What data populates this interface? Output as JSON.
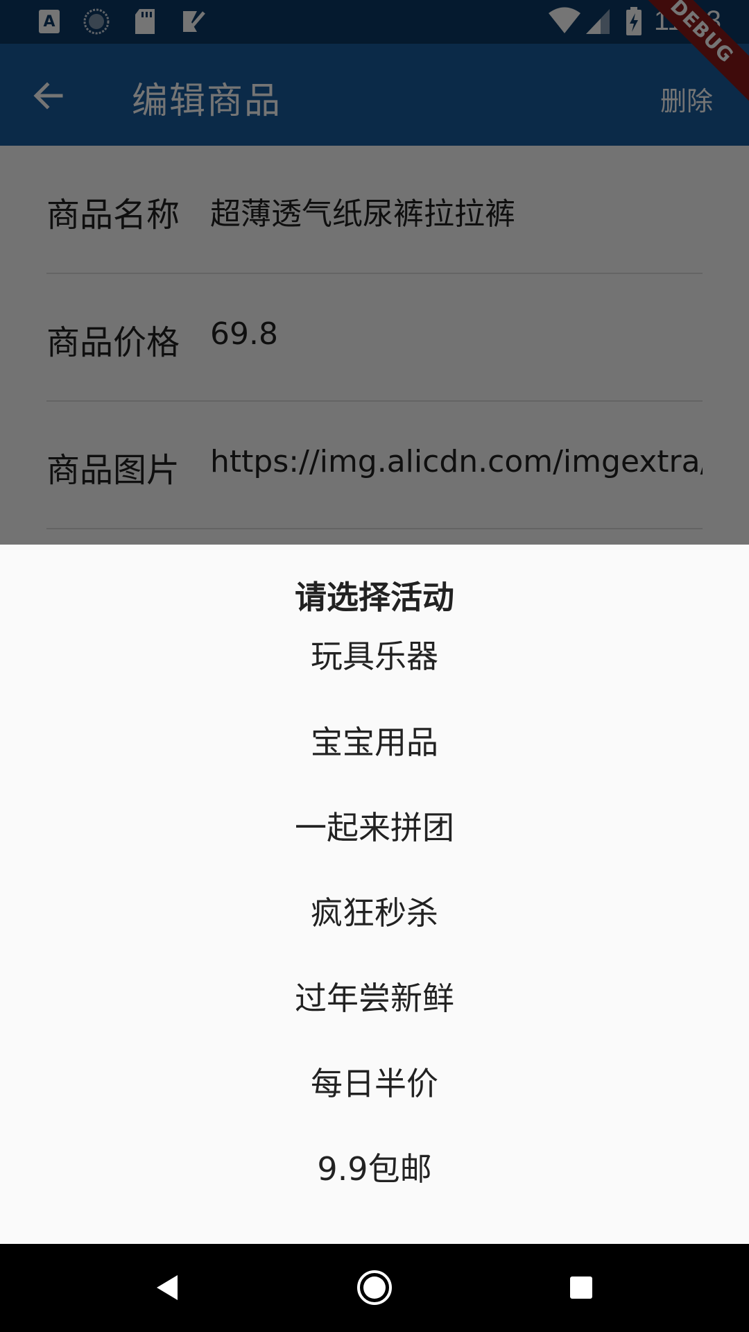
{
  "status_bar": {
    "time": "11:43",
    "left_icons": [
      "keyboard-a-icon",
      "sync-circle-icon",
      "sd-card-icon",
      "task-check-icon"
    ],
    "right_icons": [
      "wifi-icon",
      "cellular-signal-icon",
      "battery-charging-icon"
    ],
    "debug_banner": "DEBUG",
    "background": "#0d3a66"
  },
  "app_bar": {
    "title": "编辑商品",
    "delete_label": "删除",
    "background": "#1a5c9e"
  },
  "form": {
    "rows": [
      {
        "label": "商品名称",
        "value": "超薄透气纸尿裤拉拉裤"
      },
      {
        "label": "商品价格",
        "value": "69.8"
      },
      {
        "label": "商品图片",
        "value": "https://img.alicdn.com/imgextra/i"
      }
    ]
  },
  "sheet": {
    "title": "请选择活动",
    "items": [
      "玩具乐器",
      "宝宝用品",
      "一起来拼团",
      "疯狂秒杀",
      "过年尝新鲜",
      "每日半价",
      "9.9包邮"
    ]
  },
  "nav_bar": {
    "icons": [
      "nav-back-icon",
      "nav-home-icon",
      "nav-recents-icon"
    ]
  }
}
